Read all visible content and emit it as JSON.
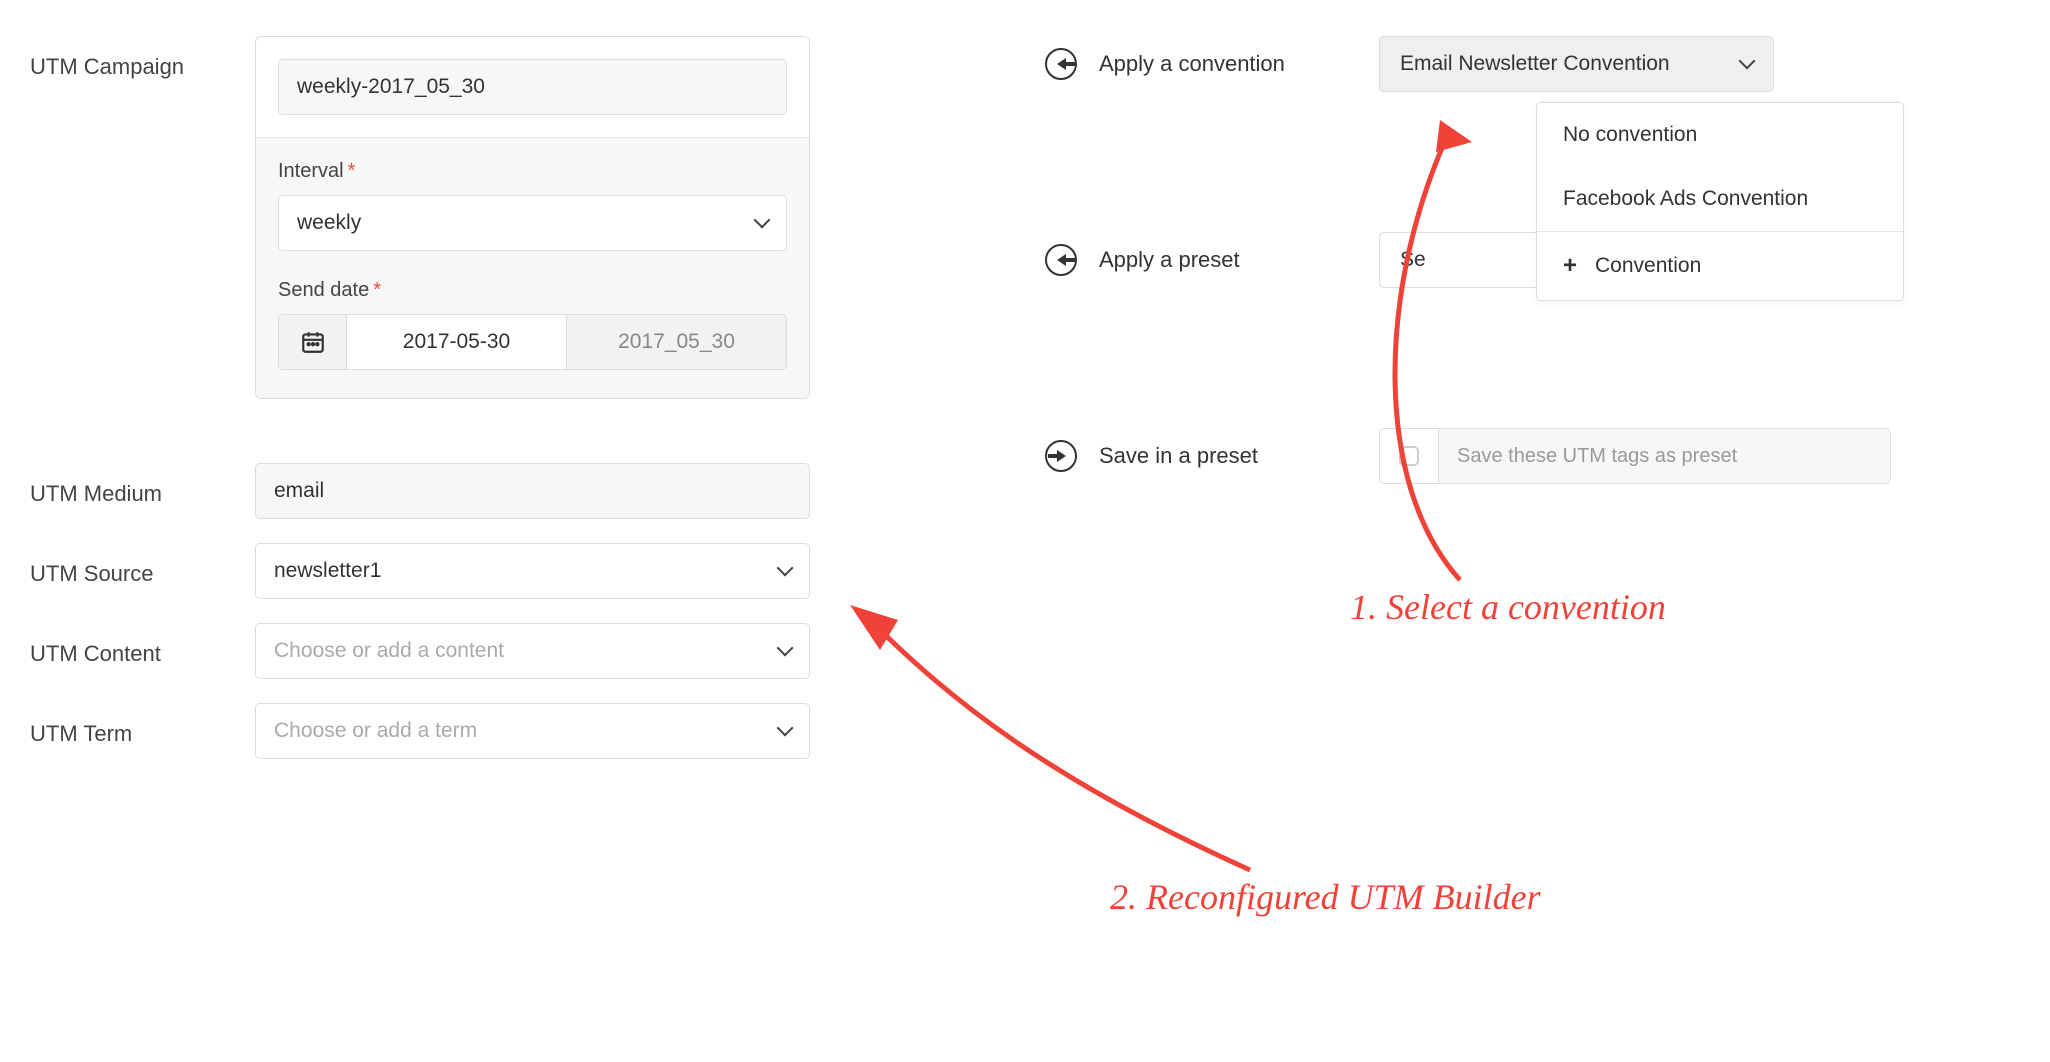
{
  "left": {
    "campaign": {
      "label": "UTM Campaign",
      "value": "weekly-2017_05_30",
      "interval_label": "Interval",
      "interval_value": "weekly",
      "senddate_label": "Send date",
      "senddate_value": "2017-05-30",
      "senddate_fmt": "2017_05_30"
    },
    "medium": {
      "label": "UTM Medium",
      "value": "email"
    },
    "source": {
      "label": "UTM Source",
      "value": "newsletter1"
    },
    "content": {
      "label": "UTM Content",
      "placeholder": "Choose or add a content"
    },
    "term": {
      "label": "UTM Term",
      "placeholder": "Choose or add a term"
    }
  },
  "right": {
    "apply_convention": {
      "label": "Apply a convention",
      "selected": "Email Newsletter Convention"
    },
    "dropdown": {
      "opt1": "No convention",
      "opt2": "Facebook Ads Convention",
      "add": "Convention"
    },
    "apply_preset": {
      "label": "Apply a preset",
      "visible_text": "Se"
    },
    "save_preset": {
      "label": "Save in a preset",
      "placeholder": "Save these UTM tags as preset"
    }
  },
  "annotations": {
    "step1": "1. Select a convention",
    "step2": "2. Reconfigured UTM Builder"
  }
}
